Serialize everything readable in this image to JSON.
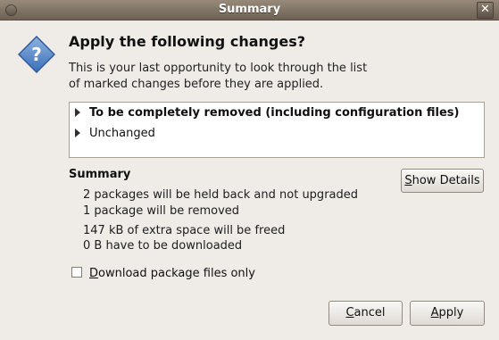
{
  "window": {
    "title": "Summary",
    "close_glyph": "✕"
  },
  "dialog": {
    "icon": "question-icon",
    "heading": "Apply the following changes?",
    "description_line1": "This is your last opportunity to look through the list",
    "description_line2": "of marked changes before they are applied."
  },
  "changes": {
    "items": [
      {
        "label": "To be completely removed (including configuration files)"
      },
      {
        "label": "Unchanged"
      }
    ]
  },
  "summary": {
    "title": "Summary",
    "lines": [
      "2 packages will be held back and not upgraded",
      "1 package will be removed",
      "147 kB of extra space will be freed",
      "0  B have to be downloaded"
    ],
    "show_details_accel": "S",
    "show_details_rest": "how Details"
  },
  "options": {
    "download_only_accel": "D",
    "download_only_rest": "ownload package files only",
    "download_only_checked": false
  },
  "buttons": {
    "cancel_accel": "C",
    "cancel_rest": "ancel",
    "apply_accel": "A",
    "apply_rest": "pply"
  }
}
